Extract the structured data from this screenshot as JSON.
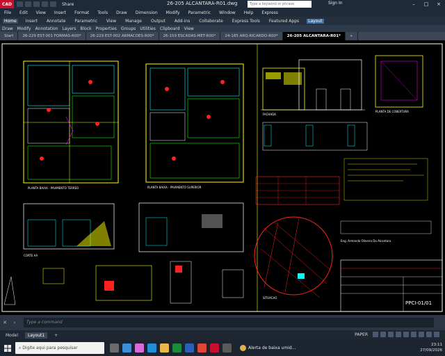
{
  "app": {
    "logo_text": "CAD",
    "share_label": "Share",
    "document_title": "26-205 ALCANTARA-R01.dwg",
    "search_placeholder": "Type a keyword or phrase",
    "sign_in_label": "Sign In"
  },
  "menu_items": [
    "File",
    "Edit",
    "View",
    "Insert",
    "Format",
    "Tools",
    "Draw",
    "Dimension",
    "Modify",
    "Parametric",
    "Window",
    "Help",
    "Express"
  ],
  "ribbon_tabs": [
    "Home",
    "Insert",
    "Annotate",
    "Parametric",
    "View",
    "Manage",
    "Output",
    "Add-ins",
    "Collaborate",
    "Express Tools",
    "Featured Apps",
    "Layout"
  ],
  "panels": [
    "Draw",
    "Modify",
    "Annotation",
    "Layers",
    "Block",
    "Properties",
    "Groups",
    "Utilities",
    "Clipboard",
    "View"
  ],
  "document_tabs": [
    "Start",
    "26-229 EST-001 FORMAS-R00*",
    "26-229 EST-002 ARMACOES-R00*",
    "26-159 ESCADAS-MET-R00*",
    "24-185 ARQ-RICARDO-R00*",
    "26-205 ALCANTARA-R01*"
  ],
  "drawing": {
    "label_plan_ground": "PLANTA BAIXA - PAVIMENTO TERREO",
    "label_plan_upper": "PLANTA BAIXA - PAVIMENTO SUPERIOR",
    "label_section": "CORTE AA",
    "label_elevation": "FACHADA",
    "label_roof": "PLANTA DE COBERTURA",
    "label_site": "SITUACAO",
    "owner_line": "Eng. Armando Oliveira Da Alcantara",
    "title_block_code": "PPCI-01/01",
    "accent_colors": {
      "yellow": "#ffff00",
      "cyan": "#00ffff",
      "red": "#ff2020",
      "green": "#00ff00",
      "magenta": "#ff00ff",
      "white": "#ffffff"
    }
  },
  "command": {
    "placeholder": "Type a command"
  },
  "layout_tabs": [
    "Model",
    "Layout1",
    "+"
  ],
  "status": {
    "paper_label": "PAPER"
  },
  "taskbar": {
    "search_placeholder": "Digite aqui para pesquisar",
    "notification": "Alerta de baixa umid...",
    "time": "23:11",
    "date": "27/09/2026"
  }
}
